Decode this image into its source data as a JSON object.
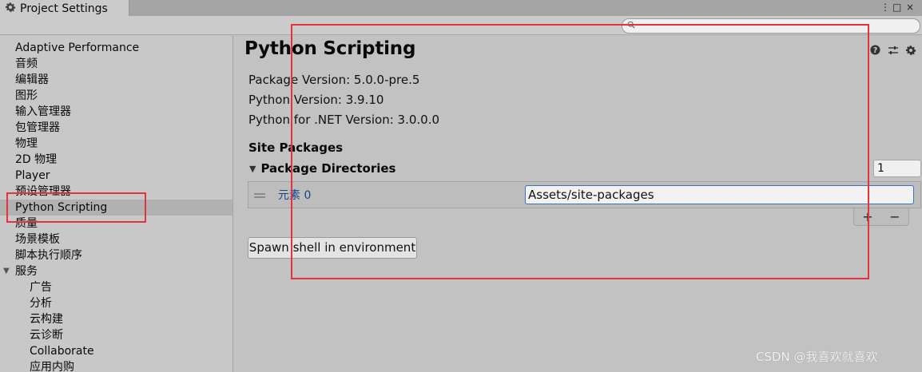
{
  "window": {
    "tab_title": "Project Settings",
    "controls": [
      "⋮",
      "□",
      "×"
    ]
  },
  "search": {
    "placeholder": ""
  },
  "sidebar": {
    "items": [
      {
        "label": "Adaptive Performance"
      },
      {
        "label": "音频"
      },
      {
        "label": "编辑器"
      },
      {
        "label": "图形"
      },
      {
        "label": "输入管理器"
      },
      {
        "label": "包管理器"
      },
      {
        "label": "物理"
      },
      {
        "label": "2D 物理"
      },
      {
        "label": "Player"
      },
      {
        "label": "预设管理器"
      },
      {
        "label": "Python Scripting"
      },
      {
        "label": "质量"
      },
      {
        "label": "场景模板"
      },
      {
        "label": "脚本执行顺序"
      },
      {
        "label": "服务"
      },
      {
        "label": "广告"
      },
      {
        "label": "分析"
      },
      {
        "label": "云构建"
      },
      {
        "label": "云诊断"
      },
      {
        "label": "Collaborate"
      },
      {
        "label": "应用内购"
      }
    ],
    "selected": "Python Scripting"
  },
  "main": {
    "title": "Python Scripting",
    "package_version": "Package Version: 5.0.0-pre.5",
    "python_version": "Python Version: 3.9.10",
    "pythonnet_version": "Python for .NET Version: 3.0.0.0",
    "site_packages_label": "Site Packages",
    "package_dirs_label": "Package Directories",
    "package_dirs_count": "1",
    "element_label": "元素 0",
    "element_value": "Assets/site-packages",
    "add_label": "+",
    "remove_label": "−",
    "spawn_button": "Spawn shell in environment"
  },
  "watermark": "CSDN @我喜欢就喜欢",
  "colors": {
    "highlight_box": "#e0353e",
    "selected_item": "#b1b1b1",
    "field_focus": "#3a72c4"
  }
}
